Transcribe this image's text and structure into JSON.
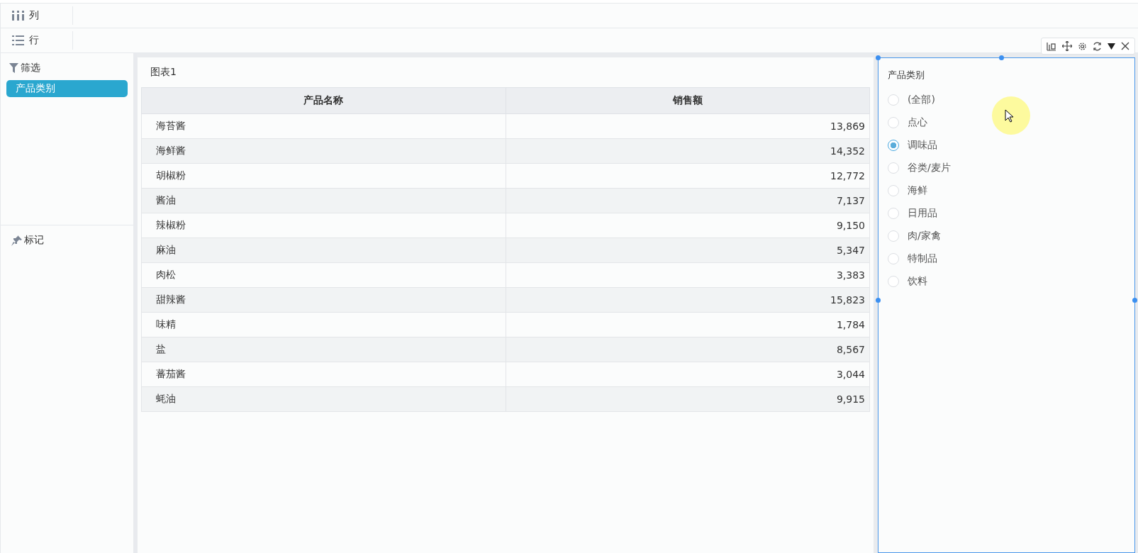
{
  "shelves": [
    {
      "kind": "columns",
      "label": "列"
    },
    {
      "kind": "rows",
      "label": "行"
    }
  ],
  "sidebar": {
    "filter_title": "筛选",
    "filter_pills": [
      "产品类别"
    ],
    "marks_title": "标记"
  },
  "chart": {
    "title": "图表1",
    "columns": [
      "产品名称",
      "销售额"
    ],
    "rows": [
      [
        "海苔酱",
        "13,869"
      ],
      [
        "海鲜酱",
        "14,352"
      ],
      [
        "胡椒粉",
        "12,772"
      ],
      [
        "酱油",
        "7,137"
      ],
      [
        "辣椒粉",
        "9,150"
      ],
      [
        "麻油",
        "5,347"
      ],
      [
        "肉松",
        "3,383"
      ],
      [
        "甜辣酱",
        "15,823"
      ],
      [
        "味精",
        "1,784"
      ],
      [
        "盐",
        "8,567"
      ],
      [
        "蕃茄酱",
        "3,044"
      ],
      [
        "蚝油",
        "9,915"
      ]
    ]
  },
  "filter_panel": {
    "title": "产品类别",
    "options": [
      {
        "label": "(全部)",
        "selected": false
      },
      {
        "label": "点心",
        "selected": false
      },
      {
        "label": "调味品",
        "selected": true
      },
      {
        "label": "谷类/麦片",
        "selected": false
      },
      {
        "label": "海鲜",
        "selected": false
      },
      {
        "label": "日用品",
        "selected": false
      },
      {
        "label": "肉/家禽",
        "selected": false
      },
      {
        "label": "特制品",
        "selected": false
      },
      {
        "label": "饮料",
        "selected": false
      }
    ]
  }
}
